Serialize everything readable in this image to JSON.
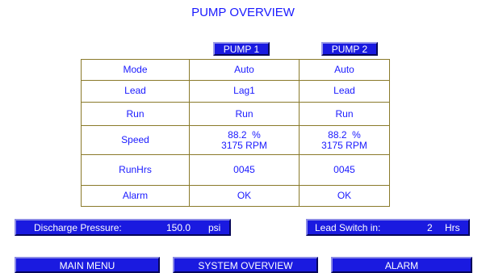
{
  "title": "PUMP OVERVIEW",
  "pumps": [
    {
      "label": "PUMP 1"
    },
    {
      "label": "PUMP 2"
    }
  ],
  "rows": [
    {
      "label": "Mode",
      "p1": "Auto",
      "p2": "Auto"
    },
    {
      "label": "Lead",
      "p1": "Lag1",
      "p2": "Lead"
    },
    {
      "label": "Run",
      "p1": "Run",
      "p2": "Run"
    },
    {
      "label": "Speed",
      "p1": "88.2  %",
      "p1b": "3175 RPM",
      "p2": "88.2  %",
      "p2b": "3175 RPM"
    },
    {
      "label": "RunHrs",
      "p1": "0045",
      "p2": "0045"
    },
    {
      "label": "Alarm",
      "p1": "OK",
      "p2": "OK"
    }
  ],
  "discharge": {
    "label": "Discharge Pressure:",
    "value": "150.0",
    "unit": "psi"
  },
  "lead_switch": {
    "label": "Lead Switch in:",
    "value": "2",
    "unit": "Hrs"
  },
  "nav": {
    "main_menu": "MAIN MENU",
    "system_overview": "SYSTEM OVERVIEW",
    "alarm": "ALARM"
  }
}
